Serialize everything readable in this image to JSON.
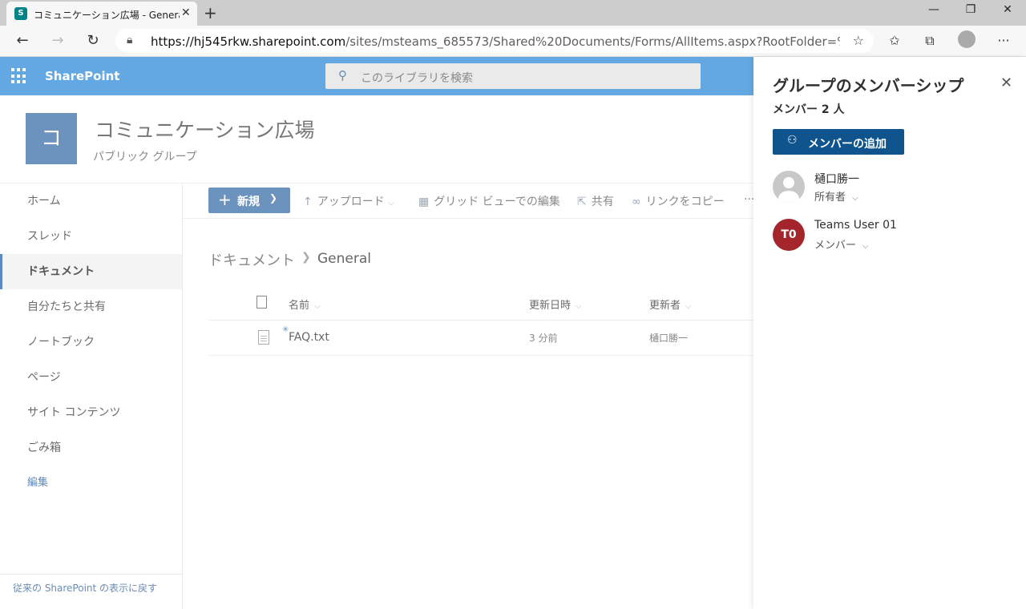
{
  "browser": {
    "tab_title": "コミュニケーション広場 - General - す",
    "tab_favicon": "S",
    "url_host": "https://hj545rkw.sharepoint.com",
    "url_path": "/sites/msteams_685573/Shared%20Documents/Forms/AllItems.aspx?RootFolder=%2Fsi..."
  },
  "suite": {
    "brand": "SharePoint",
    "search_placeholder": "このライブラリを検索",
    "bar_color": "#64a8e3"
  },
  "site": {
    "logo_letter": "コ",
    "title": "コミュニケーション広場",
    "subtitle": "パブリック グループ"
  },
  "nav": {
    "items": [
      {
        "label": "ホーム"
      },
      {
        "label": "スレッド"
      },
      {
        "label": "ドキュメント",
        "active": true
      },
      {
        "label": "自分たちと共有"
      },
      {
        "label": "ノートブック"
      },
      {
        "label": "ページ"
      },
      {
        "label": "サイト コンテンツ"
      },
      {
        "label": "ごみ箱"
      },
      {
        "label": "編集"
      }
    ],
    "classic_link": "従来の SharePoint の表示に戻す"
  },
  "commands": {
    "new": "新規",
    "upload": "アップロード",
    "grid_edit": "グリッド ビューでの編集",
    "share": "共有",
    "copy_link": "リンクをコピー",
    "more": "···"
  },
  "breadcrumb": {
    "root": "ドキュメント",
    "current": "General"
  },
  "list": {
    "columns": [
      "名前",
      "更新日時",
      "更新者"
    ],
    "rows": [
      {
        "name": "FAQ.txt",
        "modified": "3 分前",
        "modified_by": "樋口勝一"
      }
    ]
  },
  "panel": {
    "title": "グループのメンバーシップ",
    "count": "メンバー 2 人",
    "add_button": "メンバーの追加",
    "members": [
      {
        "name": "樋口勝一",
        "role": "所有者",
        "initials": "",
        "avatar": "person-placeholder-icon"
      },
      {
        "name": "Teams User 01",
        "role": "メンバー",
        "initials": "T0",
        "avatar_color": "#a4262c"
      }
    ]
  }
}
